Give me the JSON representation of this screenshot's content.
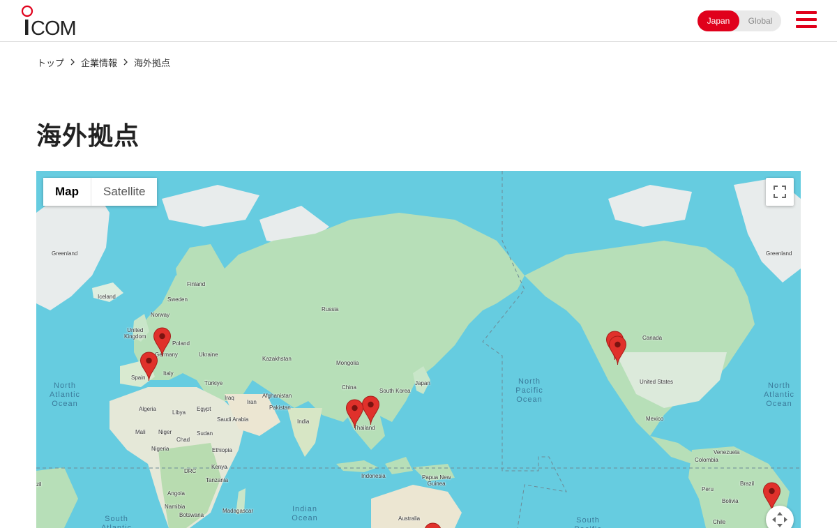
{
  "header": {
    "logo_text": "ICOM",
    "lang": {
      "active": "Japan",
      "inactive": "Global"
    }
  },
  "breadcrumb": [
    {
      "label": "トップ"
    },
    {
      "label": "企業情報"
    },
    {
      "label": "海外拠点"
    }
  ],
  "page_title": "海外拠点",
  "map": {
    "type_buttons": {
      "map": "Map",
      "satellite": "Satellite"
    },
    "active_type": "Map",
    "oceans": [
      "North\nAtlantic\nOcean",
      "North\nPacific\nOcean",
      "North\nAtlantic\nOcean",
      "Indian\nOcean",
      "South\nAtlantic",
      "South\nPacific"
    ],
    "country_labels": [
      "Greenland",
      "Greenland",
      "Iceland",
      "Finland",
      "Sweden",
      "Norway",
      "United\nKingdom",
      "Poland",
      "Germany",
      "Ukraine",
      "Spain",
      "Italy",
      "Russia",
      "Kazakhstan",
      "Mongolia",
      "China",
      "South Korea",
      "Japan",
      "Türkiye",
      "Iraq",
      "Iran",
      "Afghanistan",
      "Pakistan",
      "India",
      "Thailand",
      "Algeria",
      "Libya",
      "Egypt",
      "Saudi Arabia",
      "Mali",
      "Niger",
      "Chad",
      "Sudan",
      "Nigeria",
      "Ethiopia",
      "Kenya",
      "DRC",
      "Tanzania",
      "Angola",
      "Namibia",
      "Botswana",
      "Madagascar",
      "Indonesia",
      "Papua New\nGuinea",
      "Australia",
      "Canada",
      "United States",
      "Mexico",
      "Venezuela",
      "Colombia",
      "Peru",
      "Brazil",
      "Bolivia",
      "Chile",
      "zil"
    ],
    "marker_count": 9
  }
}
